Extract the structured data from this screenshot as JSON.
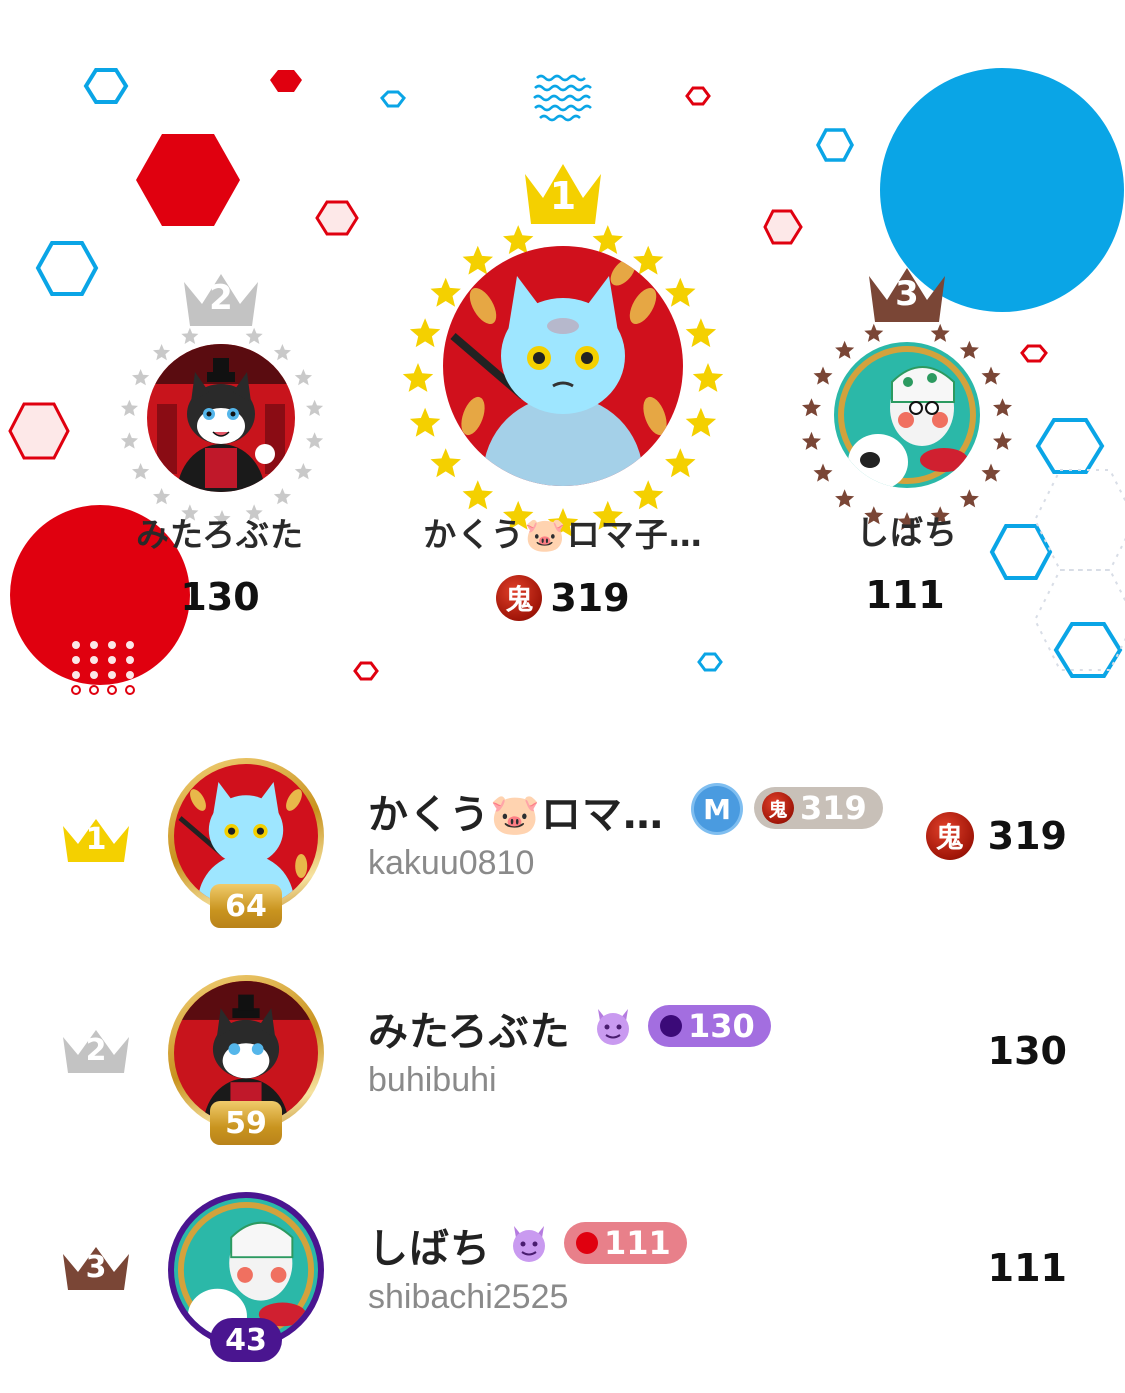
{
  "colors": {
    "gold": "#f4d000",
    "silver": "#c3c3c3",
    "bronze": "#7a4636",
    "red": "#e0000f",
    "blue": "#0aa5e6",
    "purple_pill": "#a36ee0",
    "red_pill": "#e8808a",
    "gray_pill": "#c8c0b8"
  },
  "podium": [
    {
      "rank": "2",
      "name": "みたろぶた",
      "score": "130",
      "crown": "silver-crown-icon"
    },
    {
      "rank": "1",
      "name": "かくう🐷ロマ子…",
      "score": "319",
      "badge": "鬼",
      "crown": "gold-crown-icon"
    },
    {
      "rank": "3",
      "name": "しばち",
      "score": "111",
      "crown": "bronze-crown-icon"
    }
  ],
  "list": [
    {
      "rank": "1",
      "name": "かくう🐷ロマ…",
      "handle": "kakuu0810",
      "level": "64",
      "membership_badge": "M",
      "pill_badge": "鬼",
      "pill_value": "319",
      "score_badge": "鬼",
      "score": "319"
    },
    {
      "rank": "2",
      "name": "みたろぶた",
      "handle": "buhibuhi",
      "level": "59",
      "pill_value": "130",
      "score": "130"
    },
    {
      "rank": "3",
      "name": "しばち",
      "handle": "shibachi2525",
      "level": "43",
      "pill_value": "111",
      "score": "111"
    }
  ]
}
